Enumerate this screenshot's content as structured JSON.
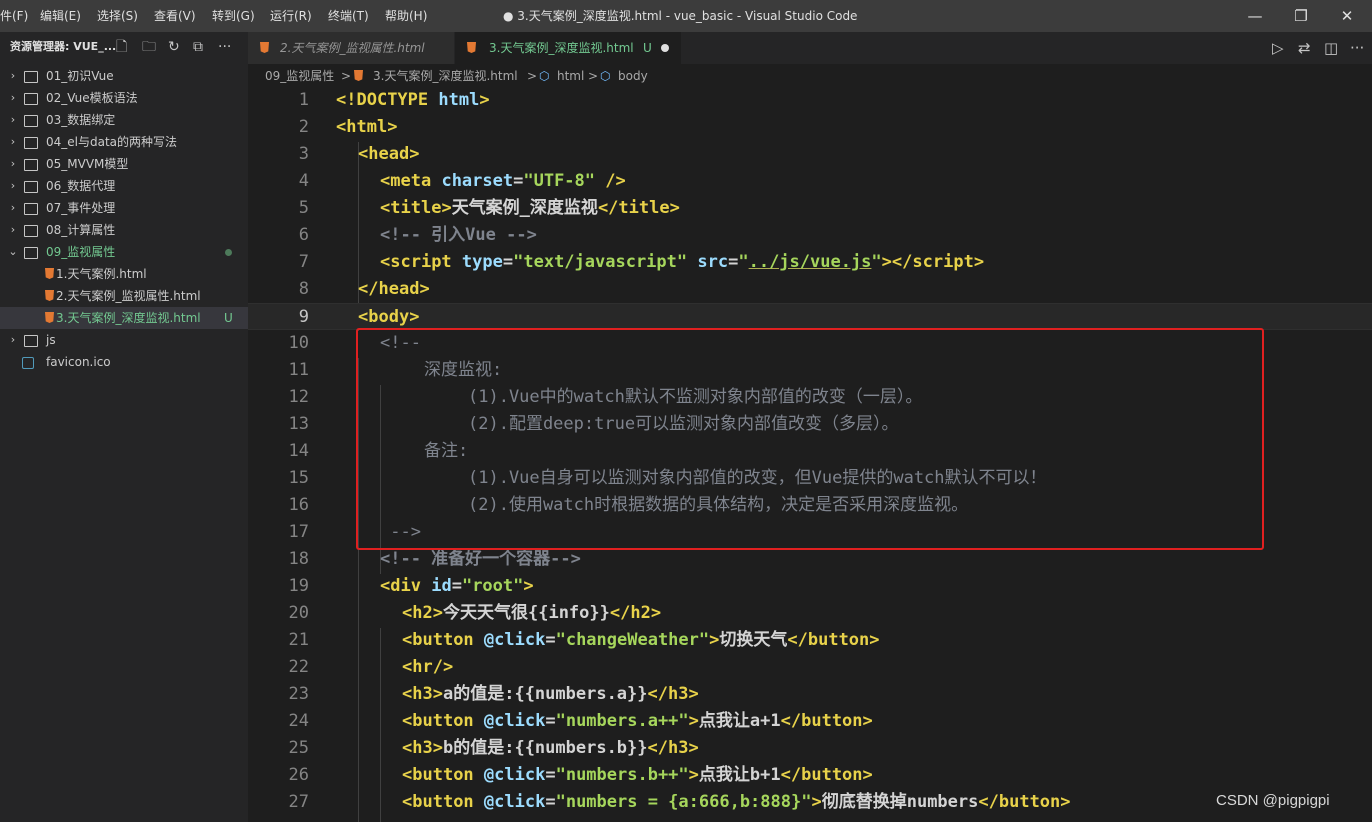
{
  "menu": [
    "件(F)",
    "编辑(E)",
    "选择(S)",
    "查看(V)",
    "转到(G)",
    "运行(R)",
    "终端(T)",
    "帮助(H)"
  ],
  "window_title": "● 3.天气案例_深度监视.html - vue_basic - Visual Studio Code",
  "window_controls": {
    "minimize": "—",
    "maximize": "❐",
    "close": "✕"
  },
  "sidebar": {
    "title": "资源管理器: VUE_...",
    "toolbar_icons": [
      "new-file-icon",
      "new-folder-icon",
      "refresh-icon",
      "collapse-all-icon",
      "more-icon"
    ],
    "toolbar_glyphs": [
      "🗋",
      "🗀",
      "↻",
      "⧉",
      "···"
    ],
    "items": [
      {
        "label": "01_初识Vue",
        "type": "folder",
        "expanded": false,
        "level": 0
      },
      {
        "label": "02_Vue模板语法",
        "type": "folder",
        "expanded": false,
        "level": 0
      },
      {
        "label": "03_数据绑定",
        "type": "folder",
        "expanded": false,
        "level": 0
      },
      {
        "label": "04_el与data的两种写法",
        "type": "folder",
        "expanded": false,
        "level": 0
      },
      {
        "label": "05_MVVM模型",
        "type": "folder",
        "expanded": false,
        "level": 0
      },
      {
        "label": "06_数据代理",
        "type": "folder",
        "expanded": false,
        "level": 0
      },
      {
        "label": "07_事件处理",
        "type": "folder",
        "expanded": false,
        "level": 0
      },
      {
        "label": "08_计算属性",
        "type": "folder",
        "expanded": false,
        "level": 0
      },
      {
        "label": "09_监视属性",
        "type": "folder",
        "expanded": true,
        "level": 0,
        "modified": true
      },
      {
        "label": "1.天气案例.html",
        "type": "html",
        "level": 1
      },
      {
        "label": "2.天气案例_监视属性.html",
        "type": "html",
        "level": 1
      },
      {
        "label": "3.天气案例_深度监视.html",
        "type": "html",
        "level": 1,
        "selected": true,
        "badge": "U"
      },
      {
        "label": "js",
        "type": "folder",
        "expanded": false,
        "level": 0
      },
      {
        "label": "favicon.ico",
        "type": "ico",
        "level": 0
      }
    ]
  },
  "tabs": [
    {
      "label": "2.天气案例_监视属性.html",
      "active": false
    },
    {
      "label": "3.天气案例_深度监视.html",
      "active": true,
      "badge": "U",
      "dirty": true
    }
  ],
  "editor_actions": [
    "run-icon",
    "compare-icon",
    "split-editor-icon",
    "more-icon"
  ],
  "editor_action_glyphs": [
    "▷",
    "⇄",
    "◫",
    "···"
  ],
  "breadcrumb": [
    "09_监视属性",
    "3.天气案例_深度监视.html",
    "html",
    "body"
  ],
  "breadcrumb_sep": ">",
  "code_lines": [
    {
      "n": "1",
      "indent": 0,
      "segs": [
        [
          "p",
          "<!"
        ],
        [
          "t",
          "DOCTYPE"
        ],
        [
          "d",
          " "
        ],
        [
          "a",
          "html"
        ],
        [
          "p",
          ">"
        ]
      ]
    },
    {
      "n": "2",
      "indent": 0,
      "segs": [
        [
          "p",
          "<"
        ],
        [
          "t",
          "html"
        ],
        [
          "p",
          ">"
        ]
      ]
    },
    {
      "n": "3",
      "indent": 1,
      "segs": [
        [
          "p",
          "<"
        ],
        [
          "t",
          "head"
        ],
        [
          "p",
          ">"
        ]
      ]
    },
    {
      "n": "4",
      "indent": 2,
      "segs": [
        [
          "p",
          "<"
        ],
        [
          "t",
          "meta"
        ],
        [
          "d",
          " "
        ],
        [
          "a",
          "charset"
        ],
        [
          "d",
          "="
        ],
        [
          "s2",
          "\"UTF-8\""
        ],
        [
          "d",
          " "
        ],
        [
          "p",
          "/>"
        ]
      ]
    },
    {
      "n": "5",
      "indent": 2,
      "segs": [
        [
          "p",
          "<"
        ],
        [
          "t",
          "title"
        ],
        [
          "p",
          ">"
        ],
        [
          "d",
          "天气案例_深度监视"
        ],
        [
          "p",
          "</"
        ],
        [
          "t",
          "title"
        ],
        [
          "p",
          ">"
        ]
      ]
    },
    {
      "n": "6",
      "indent": 2,
      "segs": [
        [
          "cb",
          "<!-- 引入Vue -->"
        ]
      ]
    },
    {
      "n": "7",
      "indent": 2,
      "segs": [
        [
          "p",
          "<"
        ],
        [
          "t",
          "script"
        ],
        [
          "d",
          " "
        ],
        [
          "a",
          "type"
        ],
        [
          "d",
          "="
        ],
        [
          "s2",
          "\"text/javascript\""
        ],
        [
          "d",
          " "
        ],
        [
          "a",
          "src"
        ],
        [
          "d",
          "="
        ],
        [
          "s2",
          "\""
        ],
        [
          "s2u",
          "../js/vue.js"
        ],
        [
          "s2",
          "\""
        ],
        [
          "p",
          "></"
        ],
        [
          "t",
          "script"
        ],
        [
          "p",
          ">"
        ]
      ]
    },
    {
      "n": "8",
      "indent": 1,
      "segs": [
        [
          "p",
          "</"
        ],
        [
          "t",
          "head"
        ],
        [
          "p",
          ">"
        ]
      ]
    },
    {
      "n": "9",
      "indent": 1,
      "segs": [
        [
          "p",
          "<"
        ],
        [
          "t",
          "body"
        ],
        [
          "p",
          ">"
        ]
      ],
      "current": true
    },
    {
      "n": "10",
      "indent": 2,
      "segs": [
        [
          "c",
          "<!--"
        ]
      ]
    },
    {
      "n": "11",
      "indent": 4,
      "segs": [
        [
          "c",
          "深度监视:"
        ]
      ]
    },
    {
      "n": "12",
      "indent": 6,
      "segs": [
        [
          "c",
          "(1).Vue中的watch默认不监测对象内部值的改变（一层）。"
        ]
      ]
    },
    {
      "n": "13",
      "indent": 6,
      "segs": [
        [
          "c",
          "(2).配置deep:true可以监测对象内部值改变（多层）。"
        ]
      ]
    },
    {
      "n": "14",
      "indent": 4,
      "segs": [
        [
          "c",
          "备注:"
        ]
      ]
    },
    {
      "n": "15",
      "indent": 6,
      "segs": [
        [
          "c",
          "(1).Vue自身可以监测对象内部值的改变，但Vue提供的watch默认不可以！"
        ]
      ]
    },
    {
      "n": "16",
      "indent": 6,
      "segs": [
        [
          "c",
          "(2).使用watch时根据数据的具体结构，决定是否采用深度监视。"
        ]
      ]
    },
    {
      "n": "17",
      "indent": 2,
      "segs": [
        [
          "c",
          " -->"
        ]
      ]
    },
    {
      "n": "18",
      "indent": 2,
      "segs": [
        [
          "cb",
          "<!-- 准备好一个容器-->"
        ]
      ]
    },
    {
      "n": "19",
      "indent": 2,
      "segs": [
        [
          "p",
          "<"
        ],
        [
          "t",
          "div"
        ],
        [
          "d",
          " "
        ],
        [
          "a",
          "id"
        ],
        [
          "d",
          "="
        ],
        [
          "s2",
          "\"root\""
        ],
        [
          "p",
          ">"
        ]
      ]
    },
    {
      "n": "20",
      "indent": 3,
      "segs": [
        [
          "p",
          "<"
        ],
        [
          "t",
          "h2"
        ],
        [
          "p",
          ">"
        ],
        [
          "d",
          "今天天气很{{info}}"
        ],
        [
          "p",
          "</"
        ],
        [
          "t",
          "h2"
        ],
        [
          "p",
          ">"
        ]
      ]
    },
    {
      "n": "21",
      "indent": 3,
      "segs": [
        [
          "p",
          "<"
        ],
        [
          "t",
          "button"
        ],
        [
          "d",
          " "
        ],
        [
          "a",
          "@click"
        ],
        [
          "d",
          "="
        ],
        [
          "s2",
          "\"changeWeather\""
        ],
        [
          "p",
          ">"
        ],
        [
          "d",
          "切换天气"
        ],
        [
          "p",
          "</"
        ],
        [
          "t",
          "button"
        ],
        [
          "p",
          ">"
        ]
      ]
    },
    {
      "n": "22",
      "indent": 3,
      "segs": [
        [
          "p",
          "<"
        ],
        [
          "t",
          "hr"
        ],
        [
          "p",
          "/>"
        ]
      ]
    },
    {
      "n": "23",
      "indent": 3,
      "segs": [
        [
          "p",
          "<"
        ],
        [
          "t",
          "h3"
        ],
        [
          "p",
          ">"
        ],
        [
          "d",
          "a的值是:{{numbers.a}}"
        ],
        [
          "p",
          "</"
        ],
        [
          "t",
          "h3"
        ],
        [
          "p",
          ">"
        ]
      ]
    },
    {
      "n": "24",
      "indent": 3,
      "segs": [
        [
          "p",
          "<"
        ],
        [
          "t",
          "button"
        ],
        [
          "d",
          " "
        ],
        [
          "a",
          "@click"
        ],
        [
          "d",
          "="
        ],
        [
          "s2",
          "\"numbers.a++\""
        ],
        [
          "p",
          ">"
        ],
        [
          "d",
          "点我让a+1"
        ],
        [
          "p",
          "</"
        ],
        [
          "t",
          "button"
        ],
        [
          "p",
          ">"
        ]
      ]
    },
    {
      "n": "25",
      "indent": 3,
      "segs": [
        [
          "p",
          "<"
        ],
        [
          "t",
          "h3"
        ],
        [
          "p",
          ">"
        ],
        [
          "d",
          "b的值是:{{numbers.b}}"
        ],
        [
          "p",
          "</"
        ],
        [
          "t",
          "h3"
        ],
        [
          "p",
          ">"
        ]
      ]
    },
    {
      "n": "26",
      "indent": 3,
      "segs": [
        [
          "p",
          "<"
        ],
        [
          "t",
          "button"
        ],
        [
          "d",
          " "
        ],
        [
          "a",
          "@click"
        ],
        [
          "d",
          "="
        ],
        [
          "s2",
          "\"numbers.b++\""
        ],
        [
          "p",
          ">"
        ],
        [
          "d",
          "点我让b+1"
        ],
        [
          "p",
          "</"
        ],
        [
          "t",
          "button"
        ],
        [
          "p",
          ">"
        ]
      ]
    },
    {
      "n": "27",
      "indent": 3,
      "segs": [
        [
          "p",
          "<"
        ],
        [
          "t",
          "button"
        ],
        [
          "d",
          " "
        ],
        [
          "a",
          "@click"
        ],
        [
          "d",
          "="
        ],
        [
          "s2",
          "\"numbers = {a:666,b:888}\""
        ],
        [
          "p",
          ">"
        ],
        [
          "d",
          "彻底替换掉numbers"
        ],
        [
          "p",
          "</"
        ],
        [
          "t",
          "button"
        ],
        [
          "p",
          ">"
        ]
      ]
    }
  ],
  "watermark": "CSDN @pigpigpi",
  "colors": {
    "tag": "#e8d24a",
    "attr": "#9cdcfe",
    "string": "#a6d65c",
    "comment": "#7f848e",
    "text": "#d4d4d4",
    "highlight_box": "#e02020",
    "untracked": "#73c991"
  }
}
